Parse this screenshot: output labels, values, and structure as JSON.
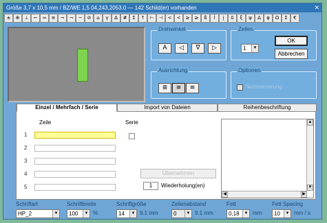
{
  "window": {
    "title": "Größe 3,7 x 10,5 mm / BZ/WE 1,5 04,243,2053.0 — 142 Schild(er) vorhanden"
  },
  "toolbar": {
    "buttons": [
      "±",
      "⊕",
      "⊥",
      "⌐",
      "≈",
      "≡",
      "¬",
      "¬",
      "~",
      "⊘",
      "⌂",
      "γ",
      "∆",
      "#",
      "Σ",
      "↑",
      "⊢",
      "⊣",
      "<",
      "<",
      "≥",
      "≥",
      "ß",
      "Ĩ",
      "į",
      "δ",
      "ξ",
      "ψ",
      "Δ",
      "φ",
      "Ω",
      "Σ",
      "€"
    ]
  },
  "drehwinkel": {
    "label": "Drehwinkel",
    "buttons": [
      "A",
      "◁",
      "∇",
      "▷"
    ]
  },
  "zeilen": {
    "label": "Zeilen",
    "value": "1"
  },
  "actions": {
    "ok": "OK",
    "cancel": "Abbrechen"
  },
  "ausrichtung": {
    "label": "Ausrichtung",
    "buttons": [
      "≣",
      "≡",
      "≡"
    ]
  },
  "optionen": {
    "label": "Optionen",
    "checkbox_label": "Nummerierung"
  },
  "tabs": [
    {
      "label": "Einzel / Mehrfach / Serie",
      "active": true
    },
    {
      "label": "Import von Dateien",
      "active": false
    },
    {
      "label": "Reihenbeschriftung",
      "active": false
    }
  ],
  "form": {
    "zeile_label": "Zeile",
    "serie_label": "Serie",
    "rows": [
      "1",
      "2",
      "3",
      "4",
      "5"
    ],
    "wiederholung_label": "Wiederholung(en)",
    "wiederholung_value": "1",
    "uebernehmen": "Übernehmen"
  },
  "bottom": {
    "schriftart": {
      "label": "Schriftart",
      "value": "HP_2"
    },
    "schriftbreite": {
      "label": "Schriftbreite",
      "value": "100",
      "unit": "%"
    },
    "schriftgroesse": {
      "label": "Schriftgröße",
      "value": "14",
      "unit": "9.1 mm"
    },
    "zeilenabstand": {
      "label": "Zeilenabstand",
      "value": "0",
      "unit": "9.1 mm"
    },
    "fett": {
      "label": "Fett",
      "value": "0,18",
      "unit": "mm"
    },
    "fett_spacing": {
      "label": "Fett Spacing",
      "value": "10",
      "unit": "mm / s"
    }
  }
}
